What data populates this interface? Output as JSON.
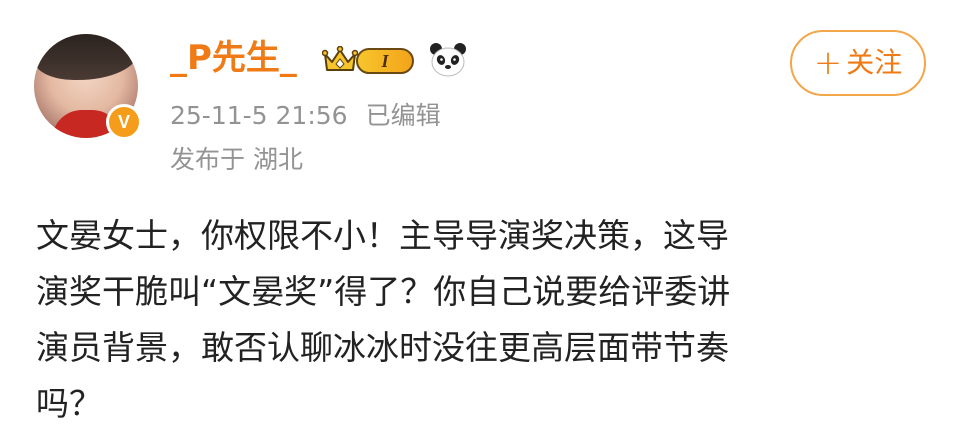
{
  "post": {
    "author": {
      "name": "_P先生_",
      "verified_badge": "V",
      "level_badge": "I",
      "avatar_icon": "user-avatar",
      "crown_icon": "crown-icon",
      "panda_icon": "panda-icon"
    },
    "timestamp": "25-11-5 21:56",
    "edited_label": "已编辑",
    "location": "发布于 湖北",
    "follow_button": {
      "plus": "+",
      "label": "关注"
    },
    "content_lines": [
      "文晏女士，你权限不小！主导导演奖决策，这导",
      "演奖干脆叫“文晏奖”得了？你自己说要给评委讲",
      "演员背景，敢否认聊冰冰时没往更高层面带节奏",
      "吗？"
    ]
  },
  "colors": {
    "username": "#f07a15",
    "meta": "#939393",
    "follow_border": "#f3a64a",
    "verified": "#f59c1b"
  }
}
